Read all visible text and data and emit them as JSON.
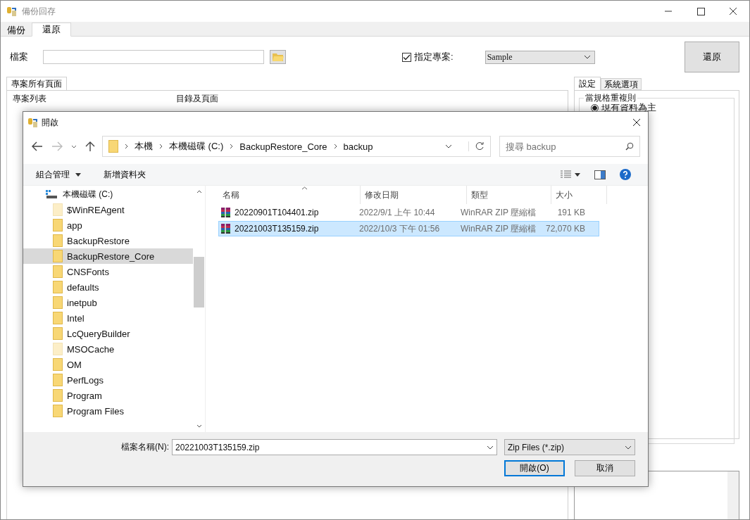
{
  "window": {
    "title": "備份回存"
  },
  "tabs": [
    {
      "label": "備份",
      "selected": false
    },
    {
      "label": "還原",
      "selected": true
    }
  ],
  "file_field": {
    "label": "檔案"
  },
  "project_checkbox": {
    "label": "指定專案:",
    "checked": true
  },
  "project_select": {
    "value": "Sample"
  },
  "restore_button": "還原",
  "left_panel": {
    "tabs": [
      {
        "label": "專案所有頁面",
        "selected": true
      }
    ],
    "columns": [
      "專案列表",
      "目錄及頁面"
    ]
  },
  "right_panel": {
    "tabs": [
      {
        "label": "設定",
        "selected": true
      },
      {
        "label": "系統選項",
        "selected": false
      }
    ],
    "group": {
      "title": "當規格重複則",
      "options": [
        {
          "label": "現有資料為主",
          "selected": true
        }
      ]
    }
  },
  "dialog": {
    "title": "開啟",
    "breadcrumbs": [
      "本機",
      "本機磁碟 (C:)",
      "BackupRestore_Core",
      "backup"
    ],
    "search": {
      "placeholder": "搜尋 backup"
    },
    "commands": [
      {
        "label": "組合管理",
        "kind": "menu"
      },
      {
        "label": "新增資料夾",
        "kind": "plain"
      }
    ],
    "tree": [
      {
        "label": "本機磁碟 (C:)",
        "kind": "drive",
        "hidden": false,
        "selected": false
      },
      {
        "label": "$WinREAgent",
        "kind": "folder",
        "hidden": true,
        "selected": false
      },
      {
        "label": "app",
        "kind": "folder",
        "hidden": false,
        "selected": false
      },
      {
        "label": "BackupRestore",
        "kind": "folder",
        "hidden": false,
        "selected": false
      },
      {
        "label": "BackupRestore_Core",
        "kind": "folder",
        "hidden": false,
        "selected": true
      },
      {
        "label": "CNSFonts",
        "kind": "folder",
        "hidden": false,
        "selected": false
      },
      {
        "label": "defaults",
        "kind": "folder",
        "hidden": false,
        "selected": false
      },
      {
        "label": "inetpub",
        "kind": "folder",
        "hidden": false,
        "selected": false
      },
      {
        "label": "Intel",
        "kind": "folder",
        "hidden": false,
        "selected": false
      },
      {
        "label": "LcQueryBuilder",
        "kind": "folder",
        "hidden": false,
        "selected": false
      },
      {
        "label": "MSOCache",
        "kind": "folder",
        "hidden": true,
        "selected": false
      },
      {
        "label": "OM",
        "kind": "folder",
        "hidden": false,
        "selected": false
      },
      {
        "label": "PerfLogs",
        "kind": "folder",
        "hidden": false,
        "selected": false
      },
      {
        "label": "Program",
        "kind": "folder",
        "hidden": false,
        "selected": false
      },
      {
        "label": "Program Files",
        "kind": "folder",
        "hidden": false,
        "selected": false
      }
    ],
    "columns": [
      "名稱",
      "修改日期",
      "類型",
      "大小"
    ],
    "files": [
      {
        "name": "20220901T104401.zip",
        "modified": "2022/9/1 上午 10:44",
        "type": "WinRAR ZIP 壓縮檔",
        "size": "191 KB",
        "selected": false
      },
      {
        "name": "20221003T135159.zip",
        "modified": "2022/10/3 下午 01:56",
        "type": "WinRAR ZIP 壓縮檔",
        "size": "72,070 KB",
        "selected": true
      }
    ],
    "filename": {
      "label": "檔案名稱(N):",
      "value": "20221003T135159.zip"
    },
    "filter": {
      "value": "Zip Files (*.zip)"
    },
    "buttons": [
      {
        "label": "開啟(O)",
        "kind": "default"
      },
      {
        "label": "取消",
        "kind": "normal"
      }
    ]
  }
}
